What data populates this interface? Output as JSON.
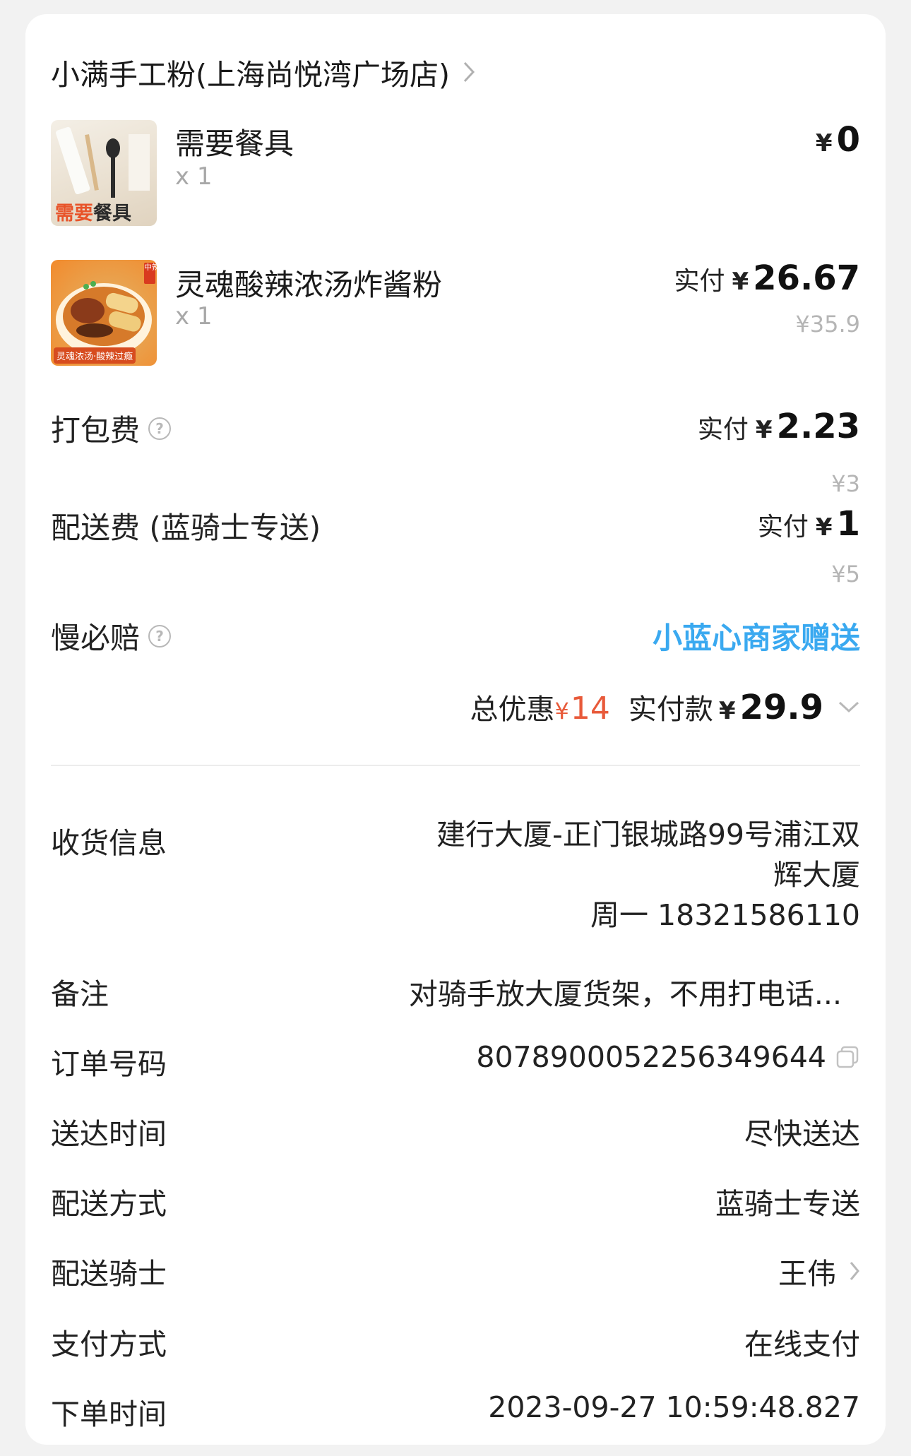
{
  "shop": {
    "name": "小满手工粉(上海尚悦湾广场店)"
  },
  "items": [
    {
      "name": "需要餐具",
      "qty": "x 1",
      "currency": "¥",
      "price": "0",
      "thumb_text_1": "需要",
      "thumb_text_2": "餐具"
    },
    {
      "name": "灵魂酸辣浓汤炸酱粉",
      "qty": "x 1",
      "paid_label": "实付",
      "currency": "¥",
      "price": "26.67",
      "original_price": "¥35.9",
      "thumb_caption": "灵魂浓汤·酸辣过瘾",
      "thumb_badge": "中辣"
    }
  ],
  "fees": {
    "packing": {
      "label": "打包费",
      "paid_label": "实付",
      "currency": "¥",
      "price": "2.23",
      "original": "¥3"
    },
    "delivery": {
      "label": "配送费 (蓝骑士专送)",
      "paid_label": "实付",
      "currency": "¥",
      "price": "1",
      "original": "¥5"
    },
    "late_guarantee": {
      "label": "慢必赔",
      "value": "小蓝心商家赠送"
    }
  },
  "help_icon_text": "?",
  "summary": {
    "discount_label": "总优惠",
    "discount_currency": "¥",
    "discount": "14",
    "total_label": "实付款",
    "total_currency": "¥",
    "total": "29.9"
  },
  "info": {
    "address": {
      "label": "收货信息",
      "line1": "建行大厦-正门银城路99号浦江双",
      "line2": "辉大厦",
      "line3": "周一 18321586110"
    },
    "note": {
      "label": "备注",
      "value": "对骑手放大厦货架，不用打电话..."
    },
    "order_no": {
      "label": "订单号码",
      "value": "8078900052256349644"
    },
    "delivery_time": {
      "label": "送达时间",
      "value": "尽快送达"
    },
    "delivery_method": {
      "label": "配送方式",
      "value": "蓝骑士专送"
    },
    "rider": {
      "label": "配送骑士",
      "value": "王伟"
    },
    "payment": {
      "label": "支付方式",
      "value": "在线支付"
    },
    "order_time": {
      "label": "下单时间",
      "value": "2023-09-27 10:59:48.827"
    }
  },
  "colors": {
    "accent_blue": "#3aa9f0",
    "discount_red": "#e85a3a"
  },
  "icons": [
    "chevron-right-icon",
    "help-icon",
    "chevron-down-icon",
    "copy-icon"
  ]
}
